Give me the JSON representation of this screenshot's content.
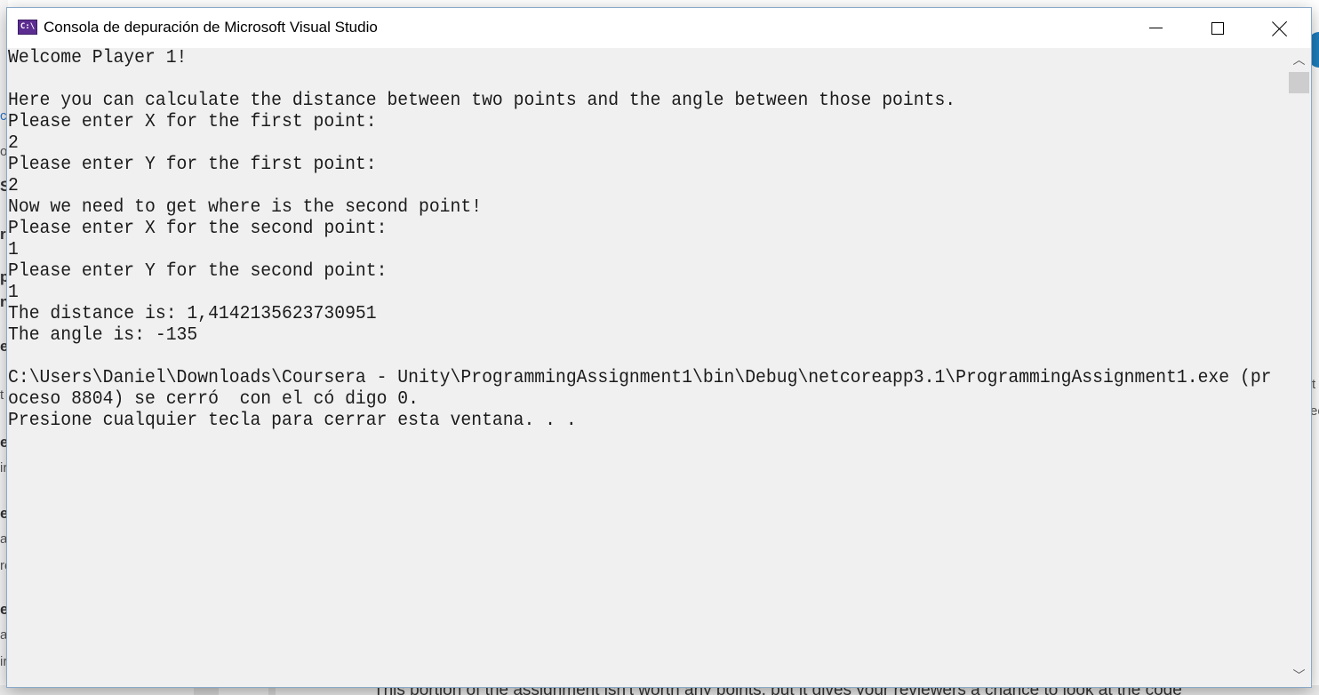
{
  "window": {
    "title": "Consola de depuración de Microsoft Visual Studio",
    "icon": "console-app-icon",
    "icon_text": "C:\\",
    "controls": {
      "minimize": "minimize-icon",
      "maximize": "maximize-icon",
      "close": "close-icon"
    }
  },
  "console": {
    "lines": [
      "Welcome Player 1!",
      "",
      "Here you can calculate the distance between two points and the angle between those points.",
      "Please enter X for the first point:",
      "2",
      "Please enter Y for the first point:",
      "2",
      "Now we need to get where is the second point!",
      "Please enter X for the second point:",
      "1",
      "Please enter Y for the second point:",
      "1",
      "The distance is: 1,4142135623730951",
      "The angle is: -135",
      "",
      "C:\\Users\\Daniel\\Downloads\\Coursera - Unity\\ProgrammingAssignment1\\bin\\Debug\\netcoreapp3.1\\ProgrammingAssignment1.exe (pr",
      "oceso 8804) se cerró  con el có digo 0.",
      "Presione cualquier tecla para cerrar esta ventana. . ."
    ]
  },
  "scrollbar": {
    "up_icon": "scroll-up-arrow-icon",
    "down_icon": "scroll-down-arrow-icon",
    "up_glyph": "︿",
    "down_glyph": "﹀"
  },
  "background": {
    "bottom_text": "This portion of the assignment isn't worth any points, but it gives your reviewers a chance to look at the code",
    "left_fragments": [
      "ct",
      "o",
      "S",
      "rs",
      "p",
      "ns",
      "e",
      "t",
      "e",
      "ir",
      "es",
      "a",
      "re",
      "e",
      "a",
      "ir"
    ],
    "right_fragments": [
      "t",
      "ee"
    ],
    "accent_color": "#2a73cc",
    "console_bg": "#f0f0f0",
    "console_text_color": "#1b1b1b",
    "icon_color": "#5c2d91"
  }
}
